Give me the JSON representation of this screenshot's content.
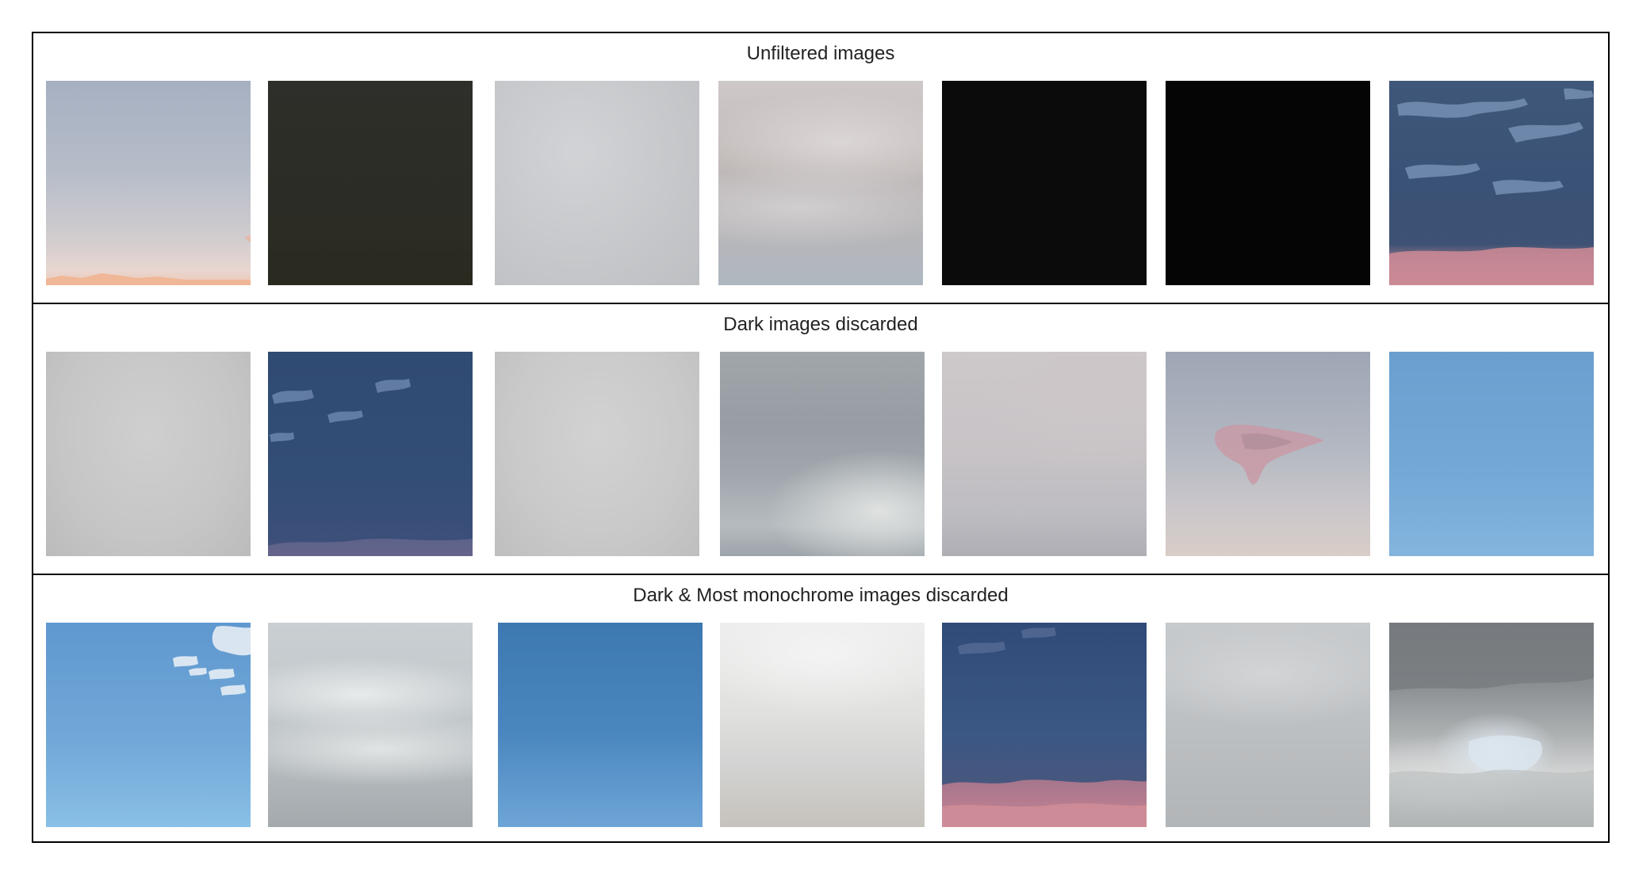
{
  "sections": [
    {
      "title": "Unfiltered images",
      "images": [
        "hazy pastel sky at sunset",
        "very dark olive sky",
        "uniform light gray overcast",
        "soft gray clouds",
        "near-black sky",
        "black sky",
        "blue sky with dark clouds and pink horizon"
      ]
    },
    {
      "title": "Dark images discarded",
      "images": [
        "light gray fog",
        "deep blue sky with scattered clouds",
        "light gray overcast",
        "gray stratocumulus clouds",
        "pale gray cloud layer",
        "pale sky with small pink cloud",
        "clear blue sky"
      ]
    },
    {
      "title": "Dark & Most monochrome images discarded",
      "images": [
        "blue sky with small white clouds",
        "gray-white cloud bands",
        "clear deeper blue sky",
        "bright overcast sky",
        "dark blue sky with pink horizon clouds",
        "light gray cloud cover",
        "dramatic gray clouds"
      ]
    }
  ]
}
